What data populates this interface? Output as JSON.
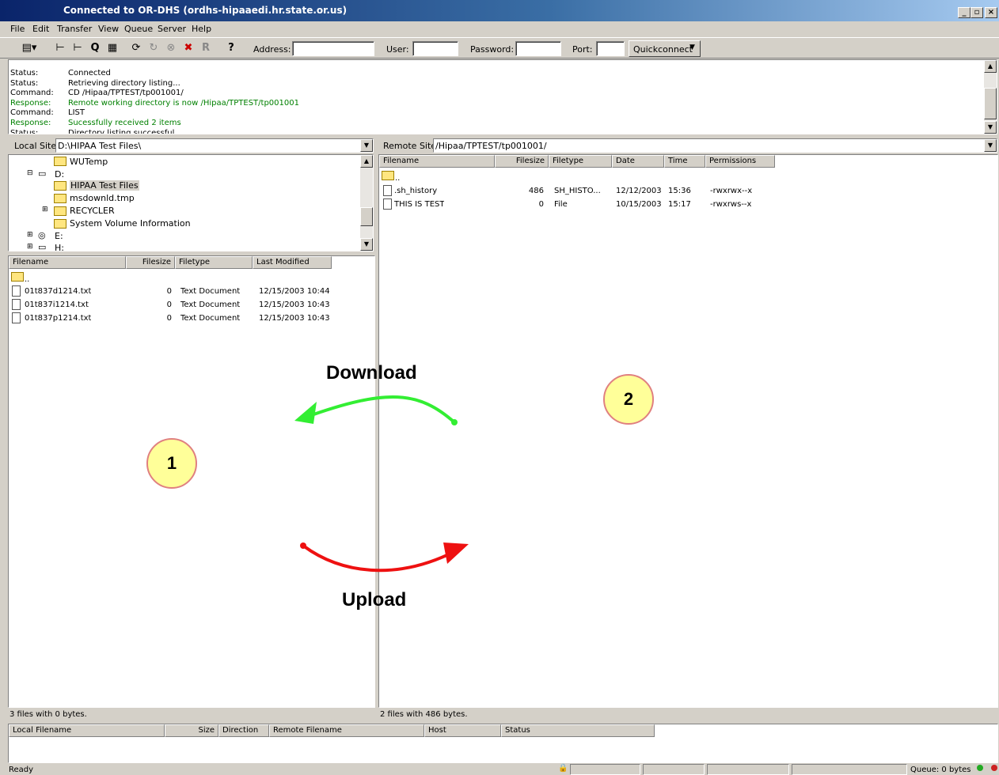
{
  "window": {
    "title": "Connected to OR-DHS (ordhs-hipaaedi.hr.state.or.us)",
    "min": "_",
    "max": "▫",
    "close": "×"
  },
  "menu": [
    "File",
    "Edit",
    "Transfer",
    "View",
    "Queue",
    "Server",
    "Help"
  ],
  "toolbar": {
    "address_label": "Address:",
    "user_label": "User:",
    "password_label": "Password:",
    "port_label": "Port:",
    "quickconnect_label": "Quickconnect",
    "address": "",
    "user": "",
    "password": "",
    "port": ""
  },
  "log": [
    {
      "k": "Status:",
      "v": "Connected",
      "c": "#000000"
    },
    {
      "k": "Status:",
      "v": "Retrieving directory listing...",
      "c": "#000000"
    },
    {
      "k": "Command:",
      "v": "CD /Hipaa/TPTEST/tp001001/",
      "c": "#000000"
    },
    {
      "k": "Response:",
      "v": "Remote working directory is now /Hipaa/TPTEST/tp001001",
      "c": "#008000"
    },
    {
      "k": "Command:",
      "v": "LIST",
      "c": "#000000"
    },
    {
      "k": "Response:",
      "v": "Sucessfully received 2 items",
      "c": "#008000"
    },
    {
      "k": "Status:",
      "v": "Directory listing successful",
      "c": "#000000"
    }
  ],
  "local": {
    "label": "Local Site:",
    "path": "D:\\HIPAA Test Files\\",
    "tree": [
      "WUTemp",
      "D:",
      "HIPAA Test Files",
      "msdownld.tmp",
      "RECYCLER",
      "System Volume Information",
      "E:",
      "H:"
    ],
    "headers": [
      "Filename",
      "Filesize",
      "Filetype",
      "Last Modified"
    ],
    "files": [
      {
        "name": "..",
        "size": "",
        "type": "",
        "date": ""
      },
      {
        "name": "01t837d1214.txt",
        "size": "0",
        "type": "Text Document",
        "date": "12/15/2003 10:44"
      },
      {
        "name": "01t837i1214.txt",
        "size": "0",
        "type": "Text Document",
        "date": "12/15/2003 10:43"
      },
      {
        "name": "01t837p1214.txt",
        "size": "0",
        "type": "Text Document",
        "date": "12/15/2003 10:43"
      }
    ],
    "status": "3 files with 0 bytes."
  },
  "remote": {
    "label": "Remote Site:",
    "path": "/Hipaa/TPTEST/tp001001/",
    "headers": [
      "Filename",
      "Filesize",
      "Filetype",
      "Date",
      "Time",
      "Permissions"
    ],
    "files": [
      {
        "name": "..",
        "size": "",
        "type": "",
        "date": "",
        "time": "",
        "perm": ""
      },
      {
        "name": ".sh_history",
        "size": "486",
        "type": "SH_HISTO...",
        "date": "12/12/2003",
        "time": "15:36",
        "perm": "-rwxrwx--x"
      },
      {
        "name": "THIS IS TEST",
        "size": "0",
        "type": "File",
        "date": "10/15/2003",
        "time": "15:17",
        "perm": "-rwxrws--x"
      }
    ],
    "status": "2 files with 486 bytes."
  },
  "queue": {
    "headers": [
      "Local Filename",
      "Size",
      "Direction",
      "Remote Filename",
      "Host",
      "Status"
    ]
  },
  "annotations": {
    "download": "Download",
    "upload": "Upload",
    "circle1": "1",
    "circle2": "2",
    "download_color": "#33ee33",
    "upload_color": "#ee1111"
  },
  "statusbar": {
    "ready": "Ready",
    "queue": "Queue: 0 bytes"
  }
}
